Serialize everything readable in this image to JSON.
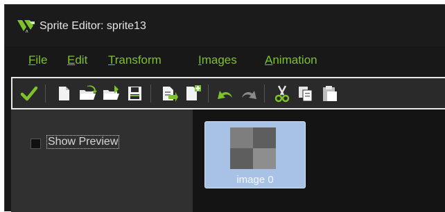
{
  "window": {
    "title": "Sprite Editor: sprite13"
  },
  "menu": {
    "items": [
      {
        "label_prefix": "F",
        "label_rest": "ile"
      },
      {
        "label_prefix": "E",
        "label_rest": "dit"
      },
      {
        "label_prefix": "T",
        "label_rest": "ransform"
      },
      {
        "label_prefix": "I",
        "label_rest": "mages"
      },
      {
        "label_prefix": "A",
        "label_rest": "nimation"
      }
    ]
  },
  "toolbar": {
    "icons": [
      "confirm-check-icon",
      "new-sprite-icon",
      "open-folder-icon",
      "open-folder-alt-icon",
      "save-icon",
      "import-image-icon",
      "add-image-icon",
      "undo-icon",
      "redo-icon",
      "cut-icon",
      "copy-icon",
      "paste-icon"
    ]
  },
  "options": {
    "show_preview_label": "Show Preview",
    "show_preview_checked": false
  },
  "images": [
    {
      "label": "image 0",
      "selected": true
    }
  ],
  "colors": {
    "accent_green": "#7ec229",
    "selection_blue": "#a8c2e6",
    "panel_dark": "#141414",
    "panel_mid": "#303030"
  }
}
